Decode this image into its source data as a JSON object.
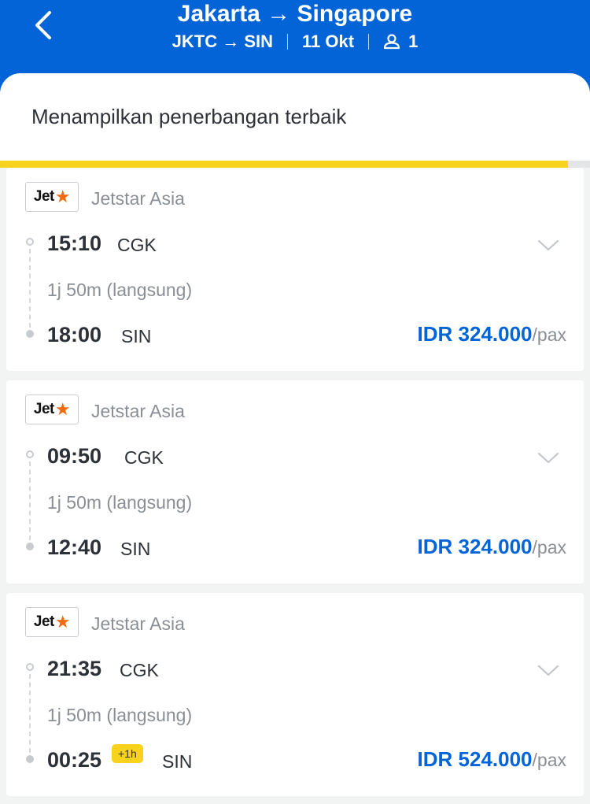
{
  "header": {
    "title": "Jakarta → Singapore",
    "origin_dest": "JKTC → SIN",
    "date": "11 Okt",
    "passengers": "1",
    "color": "#0264d6"
  },
  "subheader": {
    "text": "Menampilkan penerbangan terbaik",
    "progress_color": "#f8d21c"
  },
  "flights": [
    {
      "logo_text": "Jet",
      "logo_star": "★",
      "airline": "Jetstar Asia",
      "dep_time": "15:10",
      "dep_code": "CGK",
      "duration": "1j 50m (langsung)",
      "arr_time": "18:00",
      "arr_code": "SIN",
      "price": "IDR 324.000",
      "price_unit": "/pax"
    },
    {
      "logo_text": "Jet",
      "logo_star": "★",
      "airline": "Jetstar Asia",
      "dep_time": "09:50",
      "dep_code": "CGK",
      "duration": "1j 50m (langsung)",
      "arr_time": "12:40",
      "arr_code": "SIN",
      "price": "IDR 324.000",
      "price_unit": "/pax"
    },
    {
      "logo_text": "Jet",
      "logo_star": "★",
      "airline": "Jetstar Asia",
      "dep_time": "21:35",
      "dep_code": "CGK",
      "duration": "1j 50m (langsung)",
      "arr_time": "00:25",
      "arr_badge": "+1h",
      "arr_code": "SIN",
      "price": "IDR 524.000",
      "price_unit": "/pax"
    }
  ],
  "icons": {
    "back": "chevron-left-icon",
    "passenger": "person-icon",
    "expand": "chevron-down-icon"
  }
}
